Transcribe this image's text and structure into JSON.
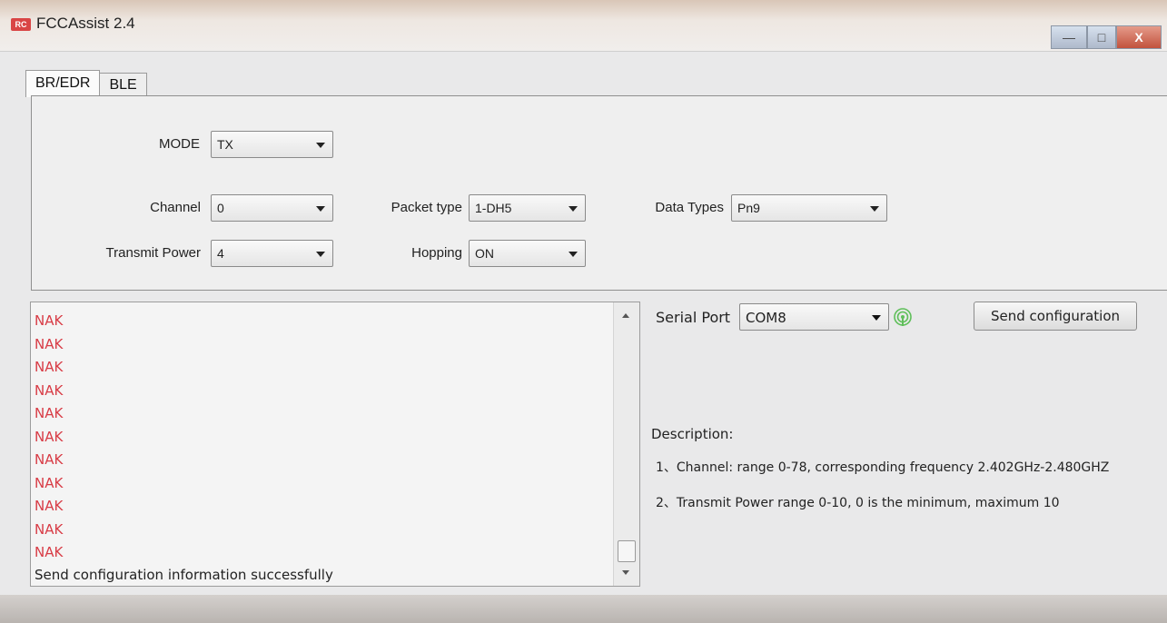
{
  "window": {
    "title": "FCCAssist 2.4",
    "icon_text": "RC",
    "minimize_glyph": "—",
    "maximize_glyph": "□",
    "close_glyph": "X"
  },
  "tabs": [
    {
      "label": "BR/EDR",
      "active": true
    },
    {
      "label": "BLE",
      "active": false
    }
  ],
  "config": {
    "mode": {
      "label": "MODE",
      "value": "TX"
    },
    "channel": {
      "label": "Channel",
      "value": "0"
    },
    "transmit_power": {
      "label": "Transmit Power",
      "value": "4"
    },
    "packet_type": {
      "label": "Packet type",
      "value": "1-DH5"
    },
    "hopping": {
      "label": "Hopping",
      "value": "ON"
    },
    "data_types": {
      "label": "Data Types",
      "value": "Pn9"
    }
  },
  "log": {
    "lines": [
      "NAK",
      "NAK",
      "NAK",
      "NAK",
      "NAK",
      "NAK",
      "NAK",
      "NAK",
      "NAK",
      "NAK",
      "NAK"
    ],
    "success_message": "Send configuration information successfully"
  },
  "serial": {
    "label": "Serial Port",
    "value": "COM8",
    "status_icon": "signal-icon",
    "status_color": "#5fbf5a"
  },
  "send_button": {
    "label": "Send configuration"
  },
  "description": {
    "title": "Description:",
    "items": [
      "1、Channel: range 0-78, corresponding frequency 2.402GHz-2.480GHZ",
      "2、Transmit Power  range 0-10, 0 is the minimum, maximum 10"
    ]
  },
  "colors": {
    "nak_text": "#d83c46",
    "close_button": "#c2523d"
  }
}
